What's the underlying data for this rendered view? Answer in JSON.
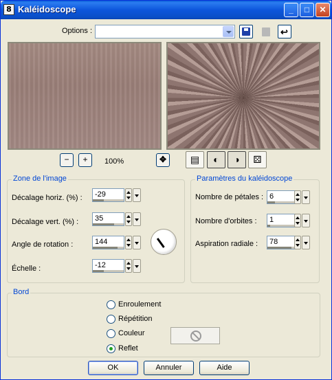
{
  "window": {
    "title": "Kaléidoscope",
    "app_icon": "8",
    "minimize": "_",
    "maximize": "□",
    "close": "✕"
  },
  "options": {
    "label": "Options :",
    "value": ""
  },
  "zoom": {
    "out_icon": "−",
    "in_icon": "+",
    "level": "100%",
    "pan_icon": "✥"
  },
  "view_buttons": {
    "b1": "▤",
    "b2": "◐",
    "b3": "◑",
    "b4": "⚄"
  },
  "zone": {
    "legend": "Zone de l'image",
    "fields": [
      {
        "label": "Décalage horiz. (%) :",
        "value": "-29",
        "level": 0.36
      },
      {
        "label": "Décalage vert. (%) :",
        "value": "35",
        "level": 0.68
      },
      {
        "label": "Angle de rotation :",
        "value": "144",
        "level": 0.8
      },
      {
        "label": "Échelle :",
        "value": "-12",
        "level": 0.35
      }
    ]
  },
  "params": {
    "legend": "Paramètres du kaléidoscope",
    "fields": [
      {
        "label": "Nombre de pétales :",
        "value": "6",
        "level": 0.25
      },
      {
        "label": "Nombre d'orbites :",
        "value": "1",
        "level": 0.08
      },
      {
        "label": "Aspiration radiale :",
        "value": "78",
        "level": 0.78
      }
    ]
  },
  "bord": {
    "legend": "Bord",
    "options": [
      {
        "label": "Enroulement",
        "checked": false
      },
      {
        "label": "Répétition",
        "checked": false
      },
      {
        "label": "Couleur",
        "checked": false
      },
      {
        "label": "Reflet",
        "checked": true
      }
    ]
  },
  "buttons": {
    "ok": "OK",
    "cancel": "Annuler",
    "help": "Aide"
  },
  "colors": {
    "title_bar": "#0a56dc",
    "accent_legend": "#0046d5",
    "dialog_bg": "#ece9d8"
  }
}
